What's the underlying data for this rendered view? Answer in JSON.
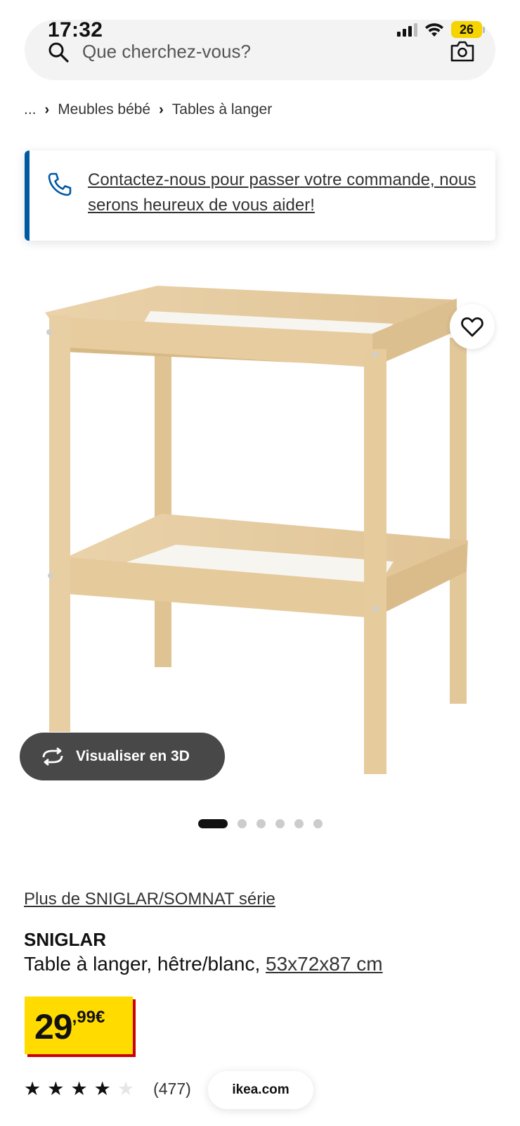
{
  "status": {
    "time": "17:32",
    "battery": "26"
  },
  "search": {
    "placeholder": "Que cherchez-vous?"
  },
  "breadcrumb": {
    "ellipsis": "...",
    "items": [
      "Meubles bébé",
      "Tables à langer"
    ]
  },
  "contact": {
    "message": "Contactez-nous pour passer votre commande, nous serons heureux de vous aider!"
  },
  "gallery": {
    "visualize_label": "Visualiser en 3D",
    "image_count": 6,
    "active_index": 0
  },
  "product": {
    "series_link": "Plus de SNIGLAR/SOMNAT série",
    "name": "SNIGLAR",
    "description": "Table à langer, hêtre/blanc,",
    "dimensions": "53x72x87 cm",
    "price_integer": "29",
    "price_decimal": ",99€",
    "rating_stars": 4,
    "rating_max": 5,
    "review_count": "(477)"
  },
  "browser": {
    "domain": "ikea.com"
  },
  "colors": {
    "brand_blue": "#0058a3",
    "price_yellow": "#ffdb00",
    "price_red": "#cc0008",
    "button_dark": "#484848"
  },
  "icons": [
    "search-icon",
    "camera-icon",
    "phone-icon",
    "heart-icon",
    "rotate-3d-icon",
    "star-icon",
    "wifi-icon",
    "signal-icon",
    "battery-icon"
  ]
}
